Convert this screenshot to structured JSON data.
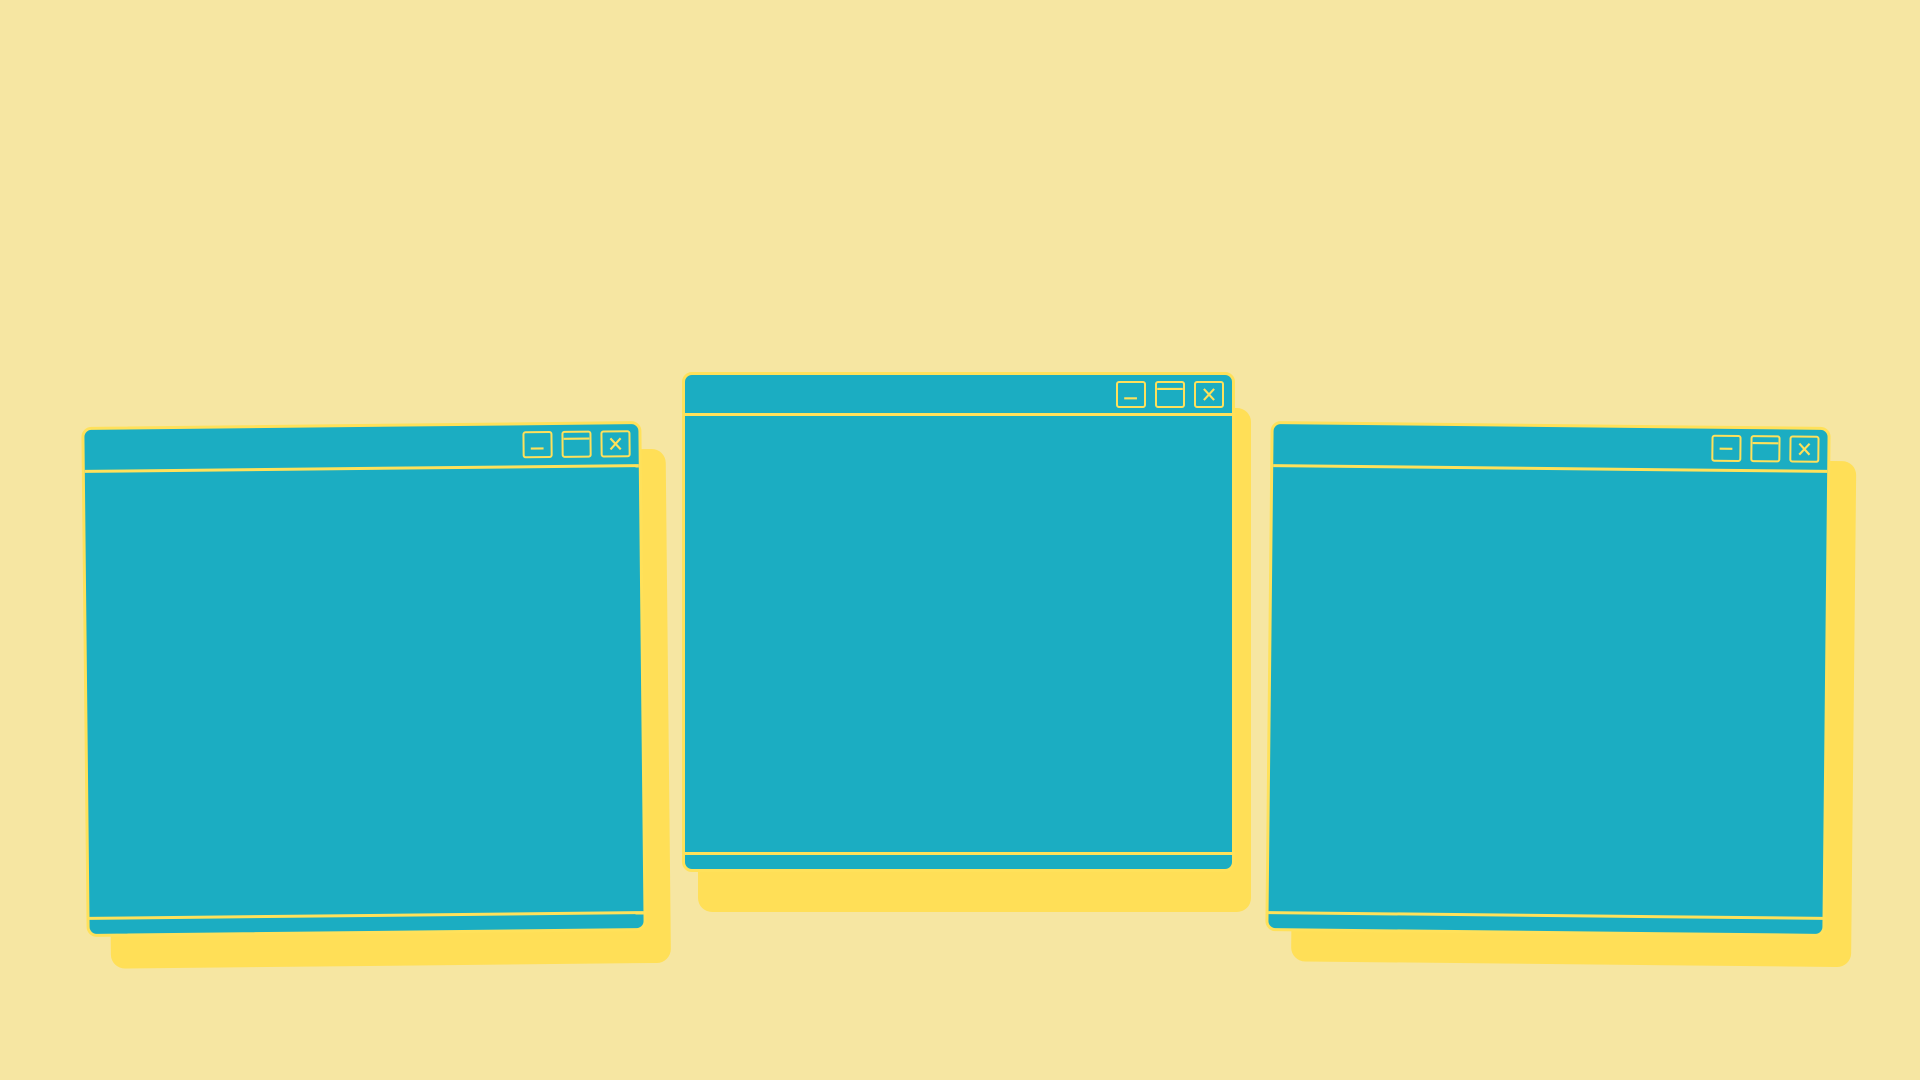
{
  "colors": {
    "background": "#F6E6A2",
    "window": "#1BADC2",
    "line": "#FFE15A",
    "shadow": "#FFDF57"
  },
  "windows": [
    {
      "name": "window-left",
      "controls": [
        "minimize-icon",
        "maximize-icon",
        "close-icon"
      ]
    },
    {
      "name": "window-center",
      "controls": [
        "minimize-icon",
        "maximize-icon",
        "close-icon"
      ]
    },
    {
      "name": "window-right",
      "controls": [
        "minimize-icon",
        "maximize-icon",
        "close-icon"
      ]
    }
  ]
}
